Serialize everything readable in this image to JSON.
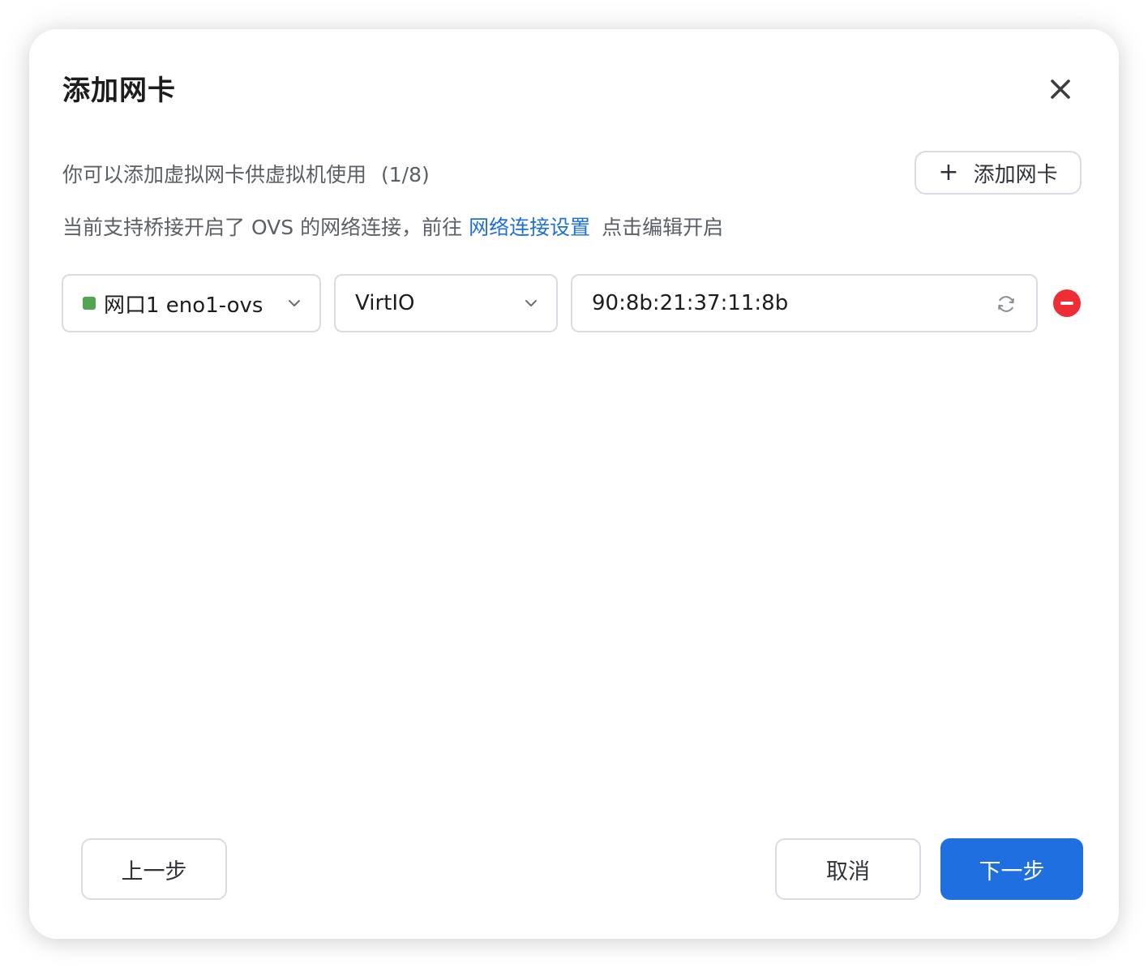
{
  "dialog": {
    "title": "添加网卡",
    "description": "你可以添加虚拟网卡供虚拟机使用",
    "count": "(1/8)",
    "add_button_label": "添加网卡",
    "hint_prefix": "当前支持桥接开启了 OVS 的网络连接，前往",
    "hint_link": "网络连接设置",
    "hint_suffix": "点击编辑开启"
  },
  "nic_rows": [
    {
      "port": "网口1 eno1-ovs",
      "port_status_color": "#52a653",
      "model": "VirtIO",
      "mac": "90:8b:21:37:11:8b"
    }
  ],
  "footer": {
    "prev_label": "上一步",
    "cancel_label": "取消",
    "next_label": "下一步"
  },
  "colors": {
    "accent": "#1f6fe0",
    "link": "#1f6fd8",
    "danger": "#ef2d35",
    "status_ok": "#52a653"
  },
  "icons": {
    "close": "close-icon",
    "add": "plus-icon",
    "dropdown": "chevron-down-icon",
    "refresh": "refresh-icon",
    "remove": "remove-circle-icon"
  }
}
